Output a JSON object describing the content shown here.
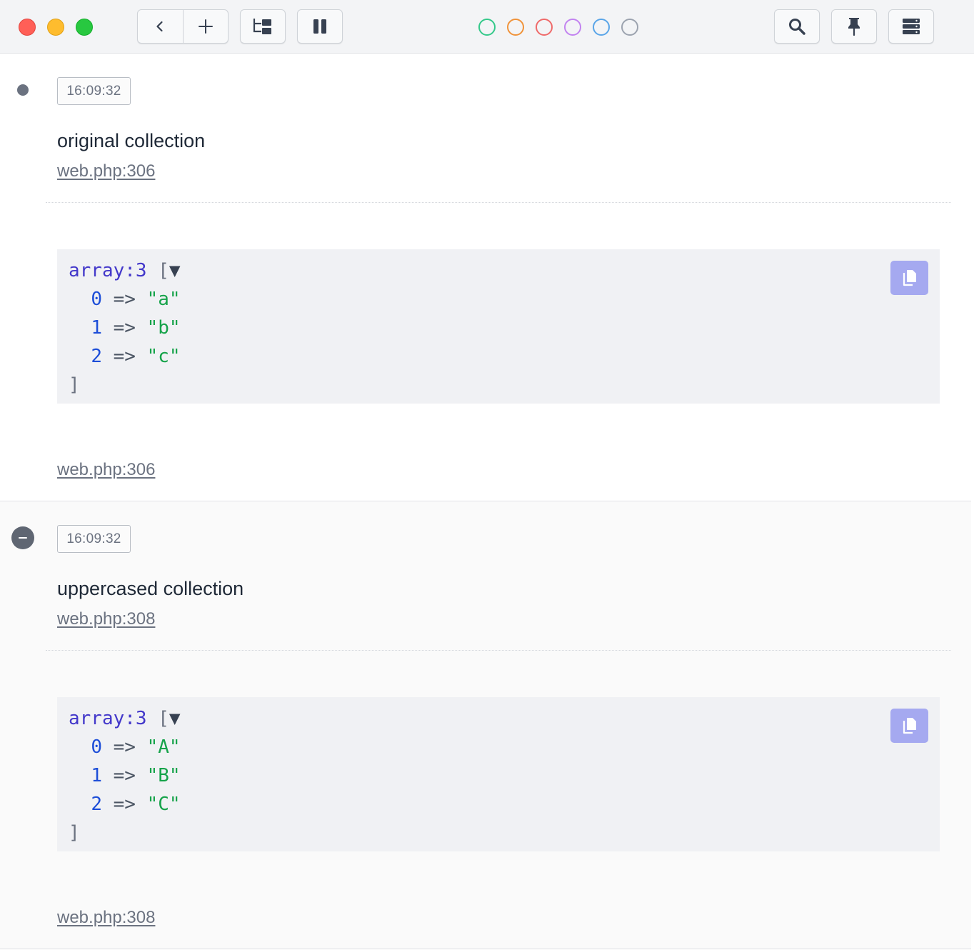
{
  "toolbar": {
    "color_filters": [
      {
        "name": "green",
        "color": "#34c98a"
      },
      {
        "name": "orange",
        "color": "#f0933a"
      },
      {
        "name": "red",
        "color": "#ef6a6a"
      },
      {
        "name": "purple",
        "color": "#c283f0"
      },
      {
        "name": "blue",
        "color": "#5aa5e8"
      },
      {
        "name": "gray",
        "color": "#9ca3af"
      }
    ]
  },
  "entries": [
    {
      "time": "16:09:32",
      "label": "original collection",
      "source": "web.php:306",
      "footer_source": "web.php:306",
      "code": {
        "type": "array:3",
        "open": "[",
        "toggle": "▼",
        "items": [
          {
            "key": "0",
            "arrow": "=>",
            "value": "\"a\""
          },
          {
            "key": "1",
            "arrow": "=>",
            "value": "\"b\""
          },
          {
            "key": "2",
            "arrow": "=>",
            "value": "\"c\""
          }
        ],
        "close": "]"
      }
    },
    {
      "time": "16:09:32",
      "label": "uppercased collection",
      "source": "web.php:308",
      "footer_source": "web.php:308",
      "code": {
        "type": "array:3",
        "open": "[",
        "toggle": "▼",
        "items": [
          {
            "key": "0",
            "arrow": "=>",
            "value": "\"A\""
          },
          {
            "key": "1",
            "arrow": "=>",
            "value": "\"B\""
          },
          {
            "key": "2",
            "arrow": "=>",
            "value": "\"C\""
          }
        ],
        "close": "]"
      }
    }
  ]
}
